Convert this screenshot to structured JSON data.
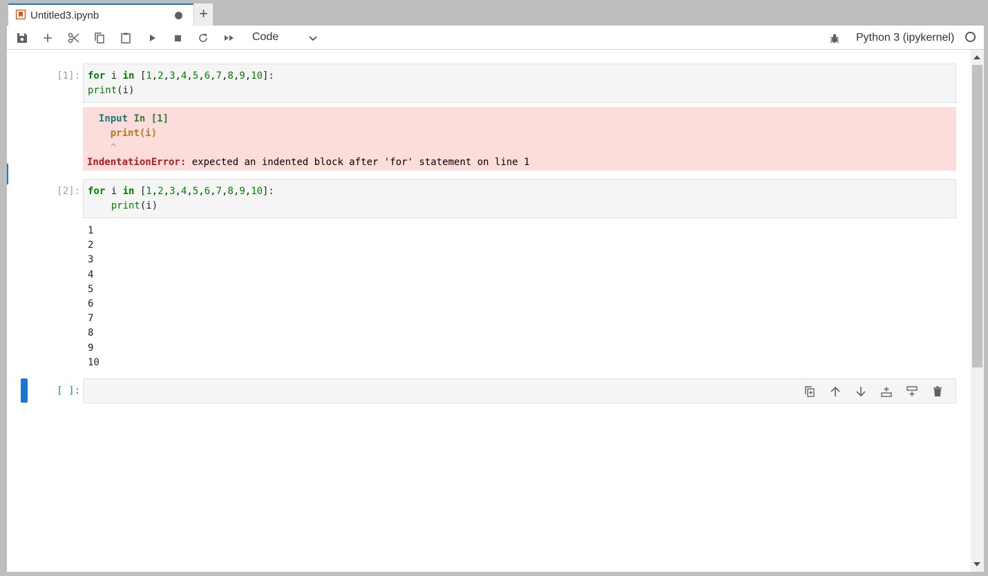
{
  "tab": {
    "title": "Untitled3.ipynb",
    "new_tab": "+"
  },
  "toolbar": {
    "cell_type": "Code",
    "kernel_name": "Python 3 (ipykernel)",
    "buttons": [
      "save",
      "insert-cell",
      "cut",
      "copy",
      "paste",
      "run",
      "stop",
      "restart",
      "run-all"
    ]
  },
  "cells": [
    {
      "prompt": "[1]:",
      "source_lines": [
        "for i in [1,2,3,4,5,6,7,8,9,10]:",
        "print(i)"
      ],
      "error": {
        "header_label": "Input In [1]",
        "code_line": "print(i)",
        "caret": "^",
        "error_name": "IndentationError:",
        "error_message": " expected an indented block after 'for' statement on line 1"
      }
    },
    {
      "prompt": "[2]:",
      "source_lines": [
        "for i in [1,2,3,4,5,6,7,8,9,10]:",
        "    print(i)"
      ],
      "output": [
        "1",
        "2",
        "3",
        "4",
        "5",
        "6",
        "7",
        "8",
        "9",
        "10"
      ]
    },
    {
      "prompt": "[ ]:",
      "source_lines": [
        ""
      ]
    }
  ],
  "colors": {
    "accent": "#1976d2",
    "error_bg": "#fddcdc",
    "keyword": "#008000"
  }
}
